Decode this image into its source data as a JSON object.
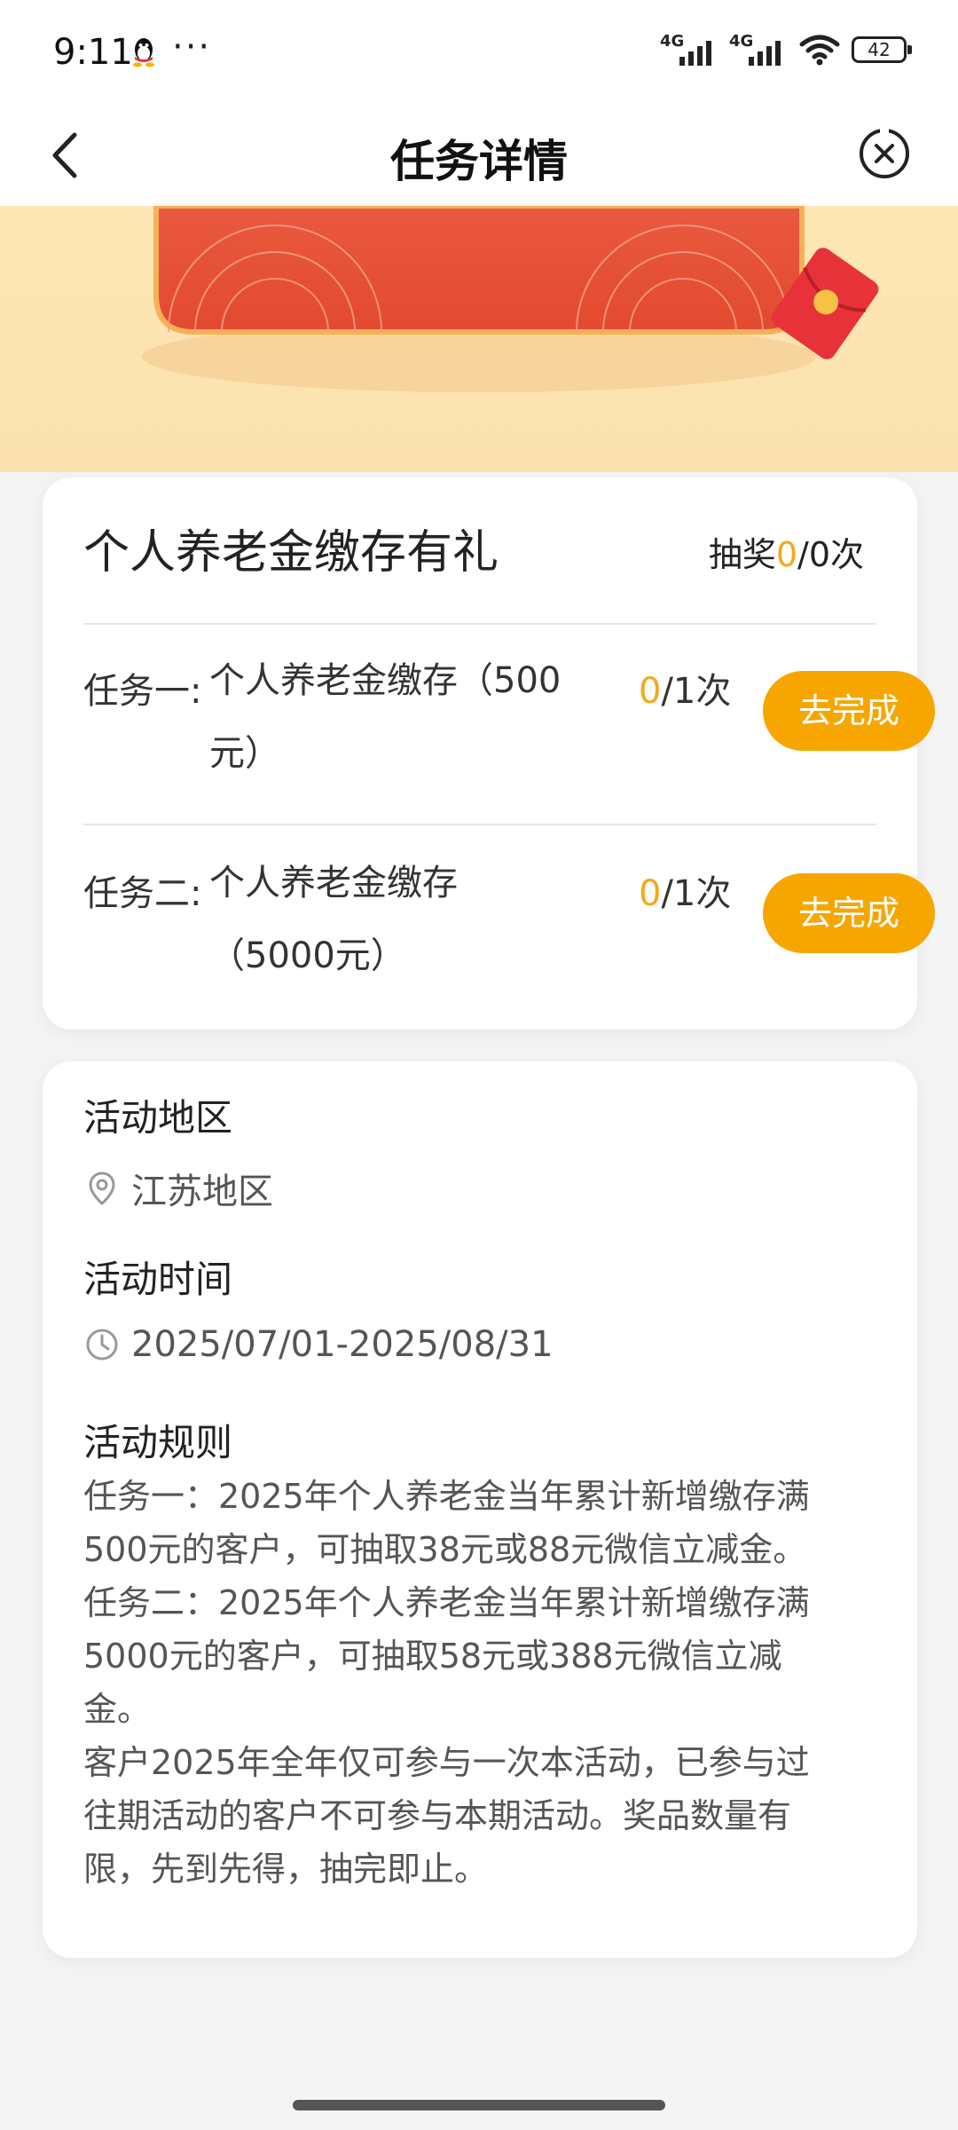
{
  "status_bar": {
    "time": "9:11",
    "more": "···",
    "signal1": "4G",
    "signal2": "4G",
    "battery": "42"
  },
  "nav": {
    "title": "任务详情"
  },
  "task_card": {
    "title": "个人养老金缴存有礼",
    "draw_prefix": "抽奖",
    "draw_current": "0",
    "draw_suffix": "/0次",
    "tasks": [
      {
        "label": "任务一:",
        "desc": "个人养老金缴存（500元）",
        "progress_current": "0",
        "progress_suffix": "/1次",
        "button": "去完成"
      },
      {
        "label": "任务二:",
        "desc": "个人养老金缴存（5000元）",
        "progress_current": "0",
        "progress_suffix": "/1次",
        "button": "去完成"
      }
    ]
  },
  "info_card": {
    "region_title": "活动地区",
    "region_value": "江苏地区",
    "time_title": "活动时间",
    "time_value": "2025/07/01-2025/08/31",
    "rules_title": "活动规则",
    "rules": [
      "任务一：2025年个人养老金当年累计新增缴存满500元的客户，可抽取38元或88元微信立减金。",
      "任务二：2025年个人养老金当年累计新增缴存满5000元的客户，可抽取58元或388元微信立减金。",
      "客户2025年全年仅可参与一次本活动，已参与过往期活动的客户不可参与本期活动。奖品数量有限，先到先得，抽完即止。"
    ]
  },
  "colors": {
    "accent": "#f7a600",
    "highlight": "#f3a81c",
    "banner_bg": "#fde7b3",
    "banner_red": "#e5533c"
  }
}
